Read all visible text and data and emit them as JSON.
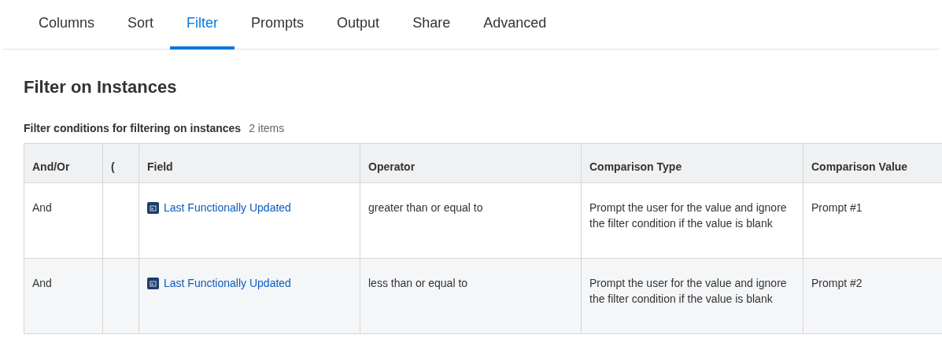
{
  "tabs": [
    {
      "label": "Columns",
      "selected": false
    },
    {
      "label": "Sort",
      "selected": false
    },
    {
      "label": "Filter",
      "selected": true
    },
    {
      "label": "Prompts",
      "selected": false
    },
    {
      "label": "Output",
      "selected": false
    },
    {
      "label": "Share",
      "selected": false
    },
    {
      "label": "Advanced",
      "selected": false
    }
  ],
  "heading": "Filter on Instances",
  "table": {
    "caption": "Filter conditions for filtering on instances",
    "count": "2 items",
    "columns": [
      "And/Or",
      "(",
      "Field",
      "Operator",
      "Comparison Type",
      "Comparison Value"
    ],
    "rows": [
      {
        "and_or": "And",
        "paren": "",
        "field": "Last Functionally Updated",
        "operator": "greater than or equal to",
        "comparison_type": "Prompt the user for the value and ignore the filter condition if the value is blank",
        "comparison_value": "Prompt #1"
      },
      {
        "and_or": "And",
        "paren": "",
        "field": "Last Functionally Updated",
        "operator": "less than or equal to",
        "comparison_type": "Prompt the user for the value and ignore the filter condition if the value is blank",
        "comparison_value": "Prompt #2"
      }
    ]
  }
}
